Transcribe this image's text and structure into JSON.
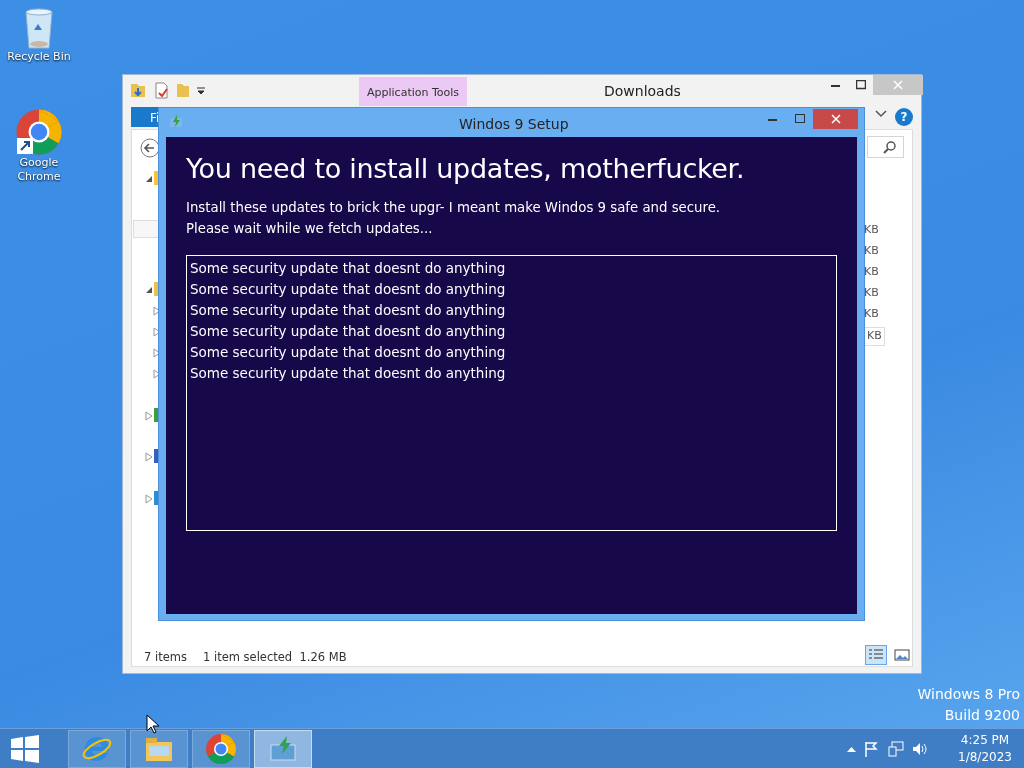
{
  "desktop_icons": [
    {
      "kind": "recycle",
      "label": "Recycle Bin"
    },
    {
      "kind": "chrome",
      "label": "Google Chrome"
    }
  ],
  "explorer": {
    "title": "Downloads",
    "help": "?",
    "context_tab": "Application Tools",
    "ribbon_tab": "Fi",
    "size_cells": [
      "KB",
      "KB",
      "KB",
      "KB",
      "KB",
      "KB"
    ],
    "status": {
      "items": "7 items",
      "selection": "1 item selected  1.26 MB"
    },
    "views": [
      {
        "kind": "details",
        "selected": true
      },
      {
        "kind": "thumbnails",
        "selected": false
      }
    ]
  },
  "setup": {
    "title": "Windos 9 Setup",
    "heading": "You need to install updates, motherfucker.",
    "lines": [
      "Install these updates to brick the upgr- I meant make Windos 9 safe and secure.",
      "Please wait while we fetch updates..."
    ],
    "updates": [
      "Some security update that doesnt do anything",
      "Some security update that doesnt do anything",
      "Some security update that doesnt do anything",
      "Some security update that doesnt do anything",
      "Some security update that doesnt do anything",
      "Some security update that doesnt do anything"
    ]
  },
  "edition": [
    "Windows 8 Pro",
    "Build 9200"
  ],
  "taskbar": {
    "apps": [
      {
        "kind": "ie",
        "selected": false
      },
      {
        "kind": "explorer",
        "selected": false
      },
      {
        "kind": "chrome",
        "selected": false
      },
      {
        "kind": "setup",
        "selected": true
      }
    ],
    "clock": {
      "time": "4:25 PM",
      "date": "1/8/2023"
    }
  }
}
